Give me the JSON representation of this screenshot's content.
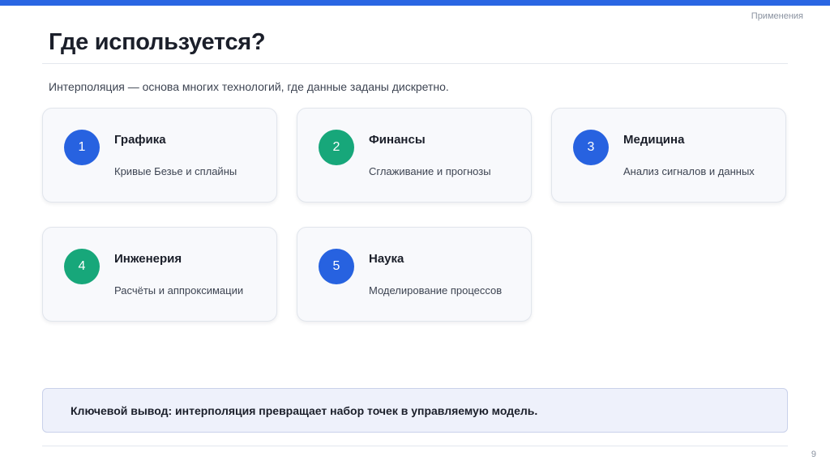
{
  "header": {
    "section_label": "Применения",
    "title": "Где используется?",
    "accent_color": "#2a66e3"
  },
  "subtitle": "Интерполяция — основа многих технологий, где данные заданы дискретно.",
  "cards": [
    {
      "number": "1",
      "title": "Графика",
      "description": "Кривые Безье и сплайны",
      "badge_color": "#2762e0"
    },
    {
      "number": "2",
      "title": "Финансы",
      "description": "Сглаживание и прогнозы",
      "badge_color": "#17a77a"
    },
    {
      "number": "3",
      "title": "Медицина",
      "description": "Анализ сигналов и данных",
      "badge_color": "#2762e0"
    },
    {
      "number": "4",
      "title": "Инженерия",
      "description": "Расчёты и аппроксимации",
      "badge_color": "#17a77a"
    },
    {
      "number": "5",
      "title": "Наука",
      "description": "Моделирование процессов",
      "badge_color": "#2762e0"
    }
  ],
  "callout": {
    "text": "Ключевой вывод: интерполяция превращает набор точек в управляемую модель."
  },
  "footer": {
    "page_number": "9"
  }
}
